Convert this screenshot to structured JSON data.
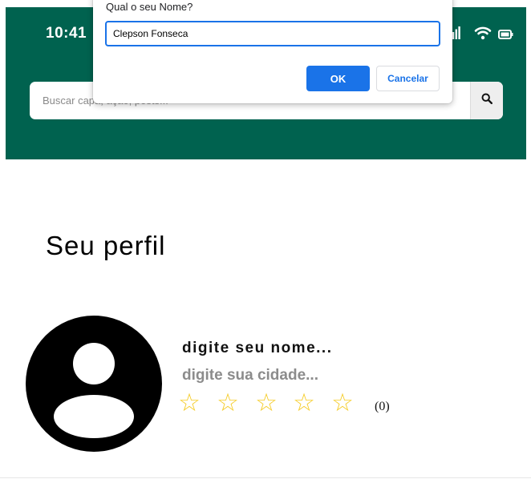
{
  "status_bar": {
    "time": "10:41",
    "icons": [
      "signal-icon",
      "wifi-icon",
      "battery-icon"
    ]
  },
  "search": {
    "placeholder": "Buscar capa, ação, posts...",
    "button_icon": "search-icon"
  },
  "profile": {
    "page_title": "Seu perfil",
    "avatar_icon": "user-avatar-icon",
    "name_placeholder": "digite seu nome...",
    "city_placeholder": "digite sua cidade...",
    "stars": [
      "☆",
      "☆",
      "☆",
      "☆",
      "☆"
    ],
    "rating_count": "(0)"
  },
  "dialog": {
    "prompt": "Qual o seu Nome?",
    "input_value": "Clepson Fonseca",
    "ok_label": "OK",
    "cancel_label": "Cancelar"
  },
  "colors": {
    "header_bg": "#00624f",
    "accent": "#1a73e8",
    "star": "#f5cc28"
  }
}
